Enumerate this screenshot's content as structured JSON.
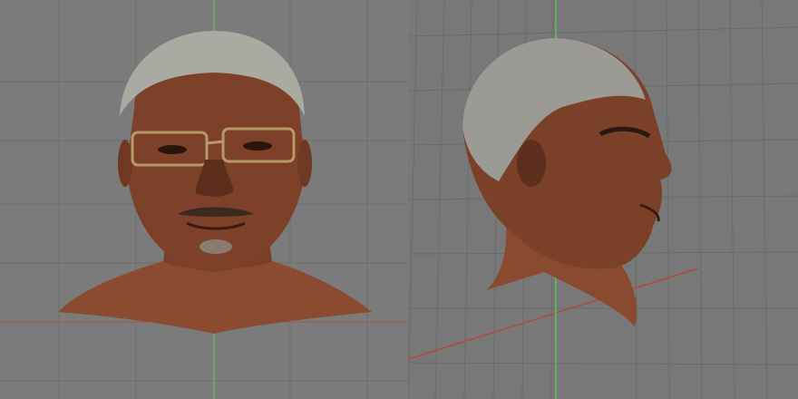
{
  "app": {
    "viewports": [
      {
        "id": "front",
        "head_model": "scanned-head-front-view"
      },
      {
        "id": "side",
        "head_model": "scanned-head-side-view"
      }
    ]
  },
  "colors": {
    "background": "#7a7a7a",
    "grid_line": "#6a6a6a",
    "axis_y_green": "#5fbf5f",
    "axis_x_red": "#b24a3a",
    "skin": "#8a4a2f",
    "skin_dark": "#5a2c1c",
    "hair": "#a8a8a0",
    "glasses_frame": "#b89a6a"
  }
}
